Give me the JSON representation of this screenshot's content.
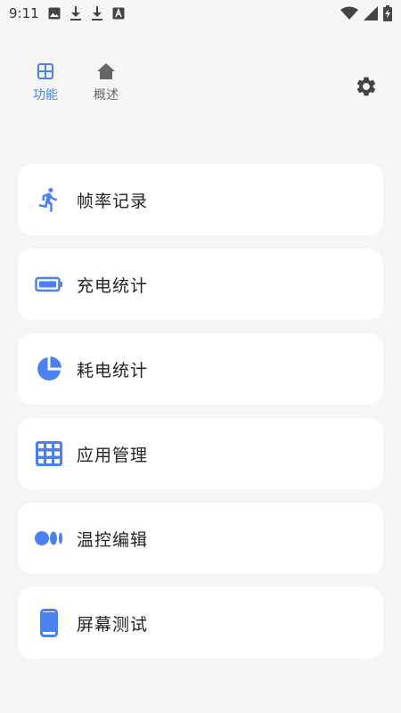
{
  "status_bar": {
    "time": "9:11",
    "icons": [
      "image-icon",
      "download-icon",
      "download-icon",
      "font-icon",
      "wifi-icon",
      "signal-icon",
      "battery-charging-icon"
    ]
  },
  "nav": {
    "tabs": [
      {
        "label": "功能",
        "icon": "grid-icon",
        "active": true
      },
      {
        "label": "概述",
        "icon": "home-icon",
        "active": false
      }
    ],
    "settings_icon": "gear-icon"
  },
  "menu": {
    "items": [
      {
        "label": "帧率记录",
        "icon": "running-icon"
      },
      {
        "label": "充电统计",
        "icon": "battery-icon"
      },
      {
        "label": "耗电统计",
        "icon": "pie-chart-icon"
      },
      {
        "label": "应用管理",
        "icon": "apps-grid-icon"
      },
      {
        "label": "温控编辑",
        "icon": "dots-icon"
      },
      {
        "label": "屏幕测试",
        "icon": "phone-icon"
      }
    ]
  },
  "colors": {
    "accent": "#4a80f0",
    "background": "#f5f5f5",
    "card": "#ffffff",
    "icon_gray": "#555555"
  }
}
